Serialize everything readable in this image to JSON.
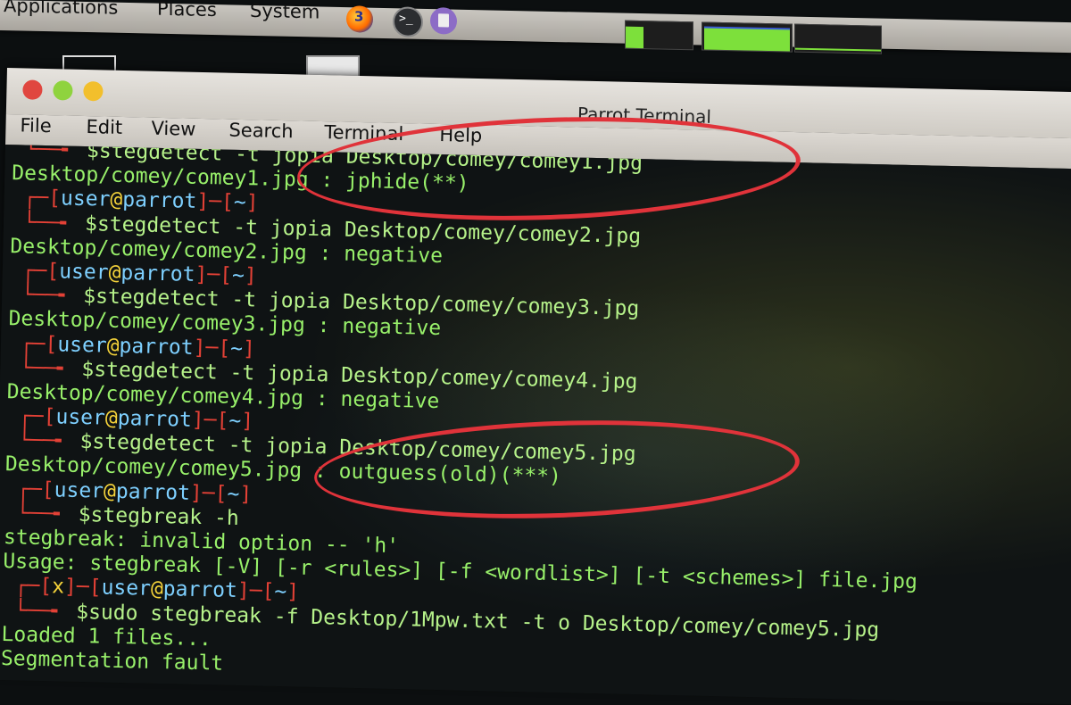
{
  "panel": {
    "menus": [
      "Applications",
      "Places",
      "System"
    ],
    "launchers": [
      "firefox-icon",
      "terminal-icon",
      "text-editor-icon"
    ],
    "terminal_launcher_glyph": ">_",
    "firefox_glyph": "3"
  },
  "window": {
    "title": "Parrot Terminal",
    "menu": [
      "File",
      "Edit",
      "View",
      "Search",
      "Terminal",
      "Help"
    ]
  },
  "terminal": {
    "lines": [
      {
        "type": "cmd2",
        "text": "$stegdetect -t jopia Desktop/comey/comey1.jpg"
      },
      {
        "type": "out",
        "text": "Desktop/comey/comey1.jpg : jphide(**)"
      },
      {
        "type": "prompt",
        "user": "user",
        "host": "parrot",
        "dir": "~"
      },
      {
        "type": "cmd2",
        "text": "$stegdetect -t jopia Desktop/comey/comey2.jpg"
      },
      {
        "type": "out",
        "text": "Desktop/comey/comey2.jpg : negative"
      },
      {
        "type": "prompt",
        "user": "user",
        "host": "parrot",
        "dir": "~"
      },
      {
        "type": "cmd2",
        "text": "$stegdetect -t jopia Desktop/comey/comey3.jpg"
      },
      {
        "type": "out",
        "text": "Desktop/comey/comey3.jpg : negative"
      },
      {
        "type": "prompt",
        "user": "user",
        "host": "parrot",
        "dir": "~"
      },
      {
        "type": "cmd2",
        "text": "$stegdetect -t jopia Desktop/comey/comey4.jpg"
      },
      {
        "type": "out",
        "text": "Desktop/comey/comey4.jpg : negative"
      },
      {
        "type": "prompt",
        "user": "user",
        "host": "parrot",
        "dir": "~"
      },
      {
        "type": "cmd2",
        "text": "$stegdetect -t jopia Desktop/comey/comey5.jpg"
      },
      {
        "type": "out",
        "text": "Desktop/comey/comey5.jpg : outguess(old)(***)"
      },
      {
        "type": "prompt",
        "user": "user",
        "host": "parrot",
        "dir": "~"
      },
      {
        "type": "cmd2",
        "text": "$stegbreak -h"
      },
      {
        "type": "out",
        "text": "stegbreak: invalid option -- 'h'"
      },
      {
        "type": "out",
        "text": "Usage: stegbreak [-V] [-r <rules>] [-f <wordlist>] [-t <schemes>] file.jpg"
      },
      {
        "type": "prompt-x",
        "x": "x",
        "user": "user",
        "host": "parrot",
        "dir": "~"
      },
      {
        "type": "cmd2",
        "text": "$sudo stegbreak -f Desktop/1Mpw.txt -t o Desktop/comey/comey5.jpg"
      },
      {
        "type": "out",
        "text": "Loaded 1 files..."
      },
      {
        "type": "out",
        "text": "Segmentation fault"
      }
    ]
  },
  "colors": {
    "output": "#98f06a",
    "prompt_bracket": "#e34136",
    "prompt_user": "#7ed0ff",
    "prompt_at": "#f5d33a",
    "annotation": "#e0333a"
  }
}
